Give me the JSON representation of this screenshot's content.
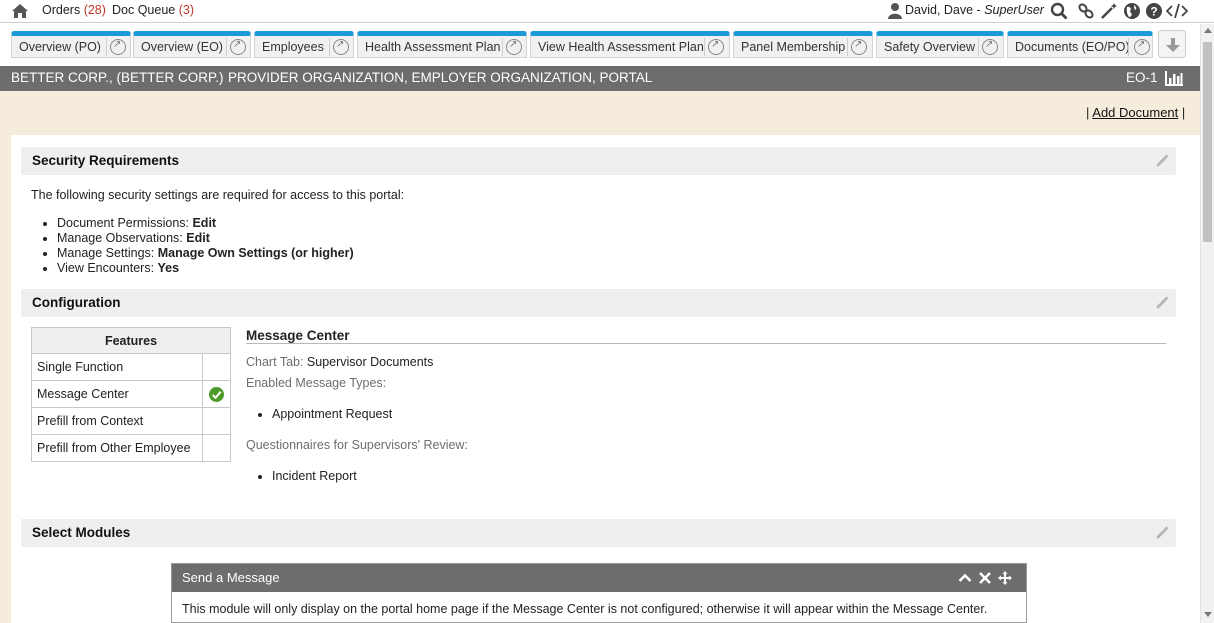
{
  "topbar": {
    "orders_label": "Orders",
    "orders_count": "(28)",
    "docqueue_label": "Doc Queue",
    "docqueue_count": "(3)",
    "user_name": "David, Dave - ",
    "user_role": "SuperUser",
    "icons": [
      "home-icon",
      "user-icon",
      "search-icon",
      "link-icon",
      "magic-wand-icon",
      "globe-icon",
      "help-icon",
      "code-icon"
    ]
  },
  "tabs": [
    {
      "label": "Overview (PO)"
    },
    {
      "label": "Overview (EO)"
    },
    {
      "label": "Employees"
    },
    {
      "label": "Health Assessment Plan"
    },
    {
      "label": "View Health Assessment Plan"
    },
    {
      "label": "Panel Membership"
    },
    {
      "label": "Safety Overview"
    },
    {
      "label": "Documents (EO/PO)"
    }
  ],
  "titlebar": {
    "org": "BETTER CORP., (BETTER CORP.)",
    "subtitle": "PROVIDER ORGANIZATION, EMPLOYER ORGANIZATION, PORTAL",
    "code": "EO-1"
  },
  "actions": {
    "sep_left": "| ",
    "add_document": "Add Document",
    "sep_right": " |"
  },
  "security": {
    "title": "Security Requirements",
    "intro": "The following security settings are required for access to this portal:",
    "items": [
      {
        "label": "Document Permissions: ",
        "value": "Edit"
      },
      {
        "label": "Manage Observations: ",
        "value": "Edit"
      },
      {
        "label": "Manage Settings: ",
        "value": "Manage Own Settings (or higher)"
      },
      {
        "label": "View Encounters: ",
        "value": "Yes"
      }
    ]
  },
  "configuration": {
    "title": "Configuration",
    "features_header": "Features",
    "features": [
      {
        "name": "Single Function",
        "enabled": false
      },
      {
        "name": "Message Center",
        "enabled": true
      },
      {
        "name": "Prefill from Context",
        "enabled": false
      },
      {
        "name": "Prefill from Other Employee",
        "enabled": false
      }
    ],
    "message_center": {
      "title": "Message Center",
      "chart_tab_label": "Chart Tab: ",
      "chart_tab_value": "Supervisor Documents",
      "enabled_types_label": "Enabled Message Types:",
      "enabled_types": [
        "Appointment Request"
      ],
      "questionnaires_label": "Questionnaires for Supervisors' Review:",
      "questionnaires": [
        "Incident Report"
      ]
    }
  },
  "select_modules": {
    "title": "Select Modules",
    "module": {
      "title": "Send a Message",
      "body": "This module will only display on the portal home page if the Message Center is not configured; otherwise it will appear within the Message Center."
    }
  },
  "colors": {
    "tab_accent": "#1a9ad6",
    "titlebar_bg": "#6d6d6d",
    "content_bg": "#f5ecdd",
    "count_red": "#c0392b",
    "check_green": "#4c9a2a"
  }
}
